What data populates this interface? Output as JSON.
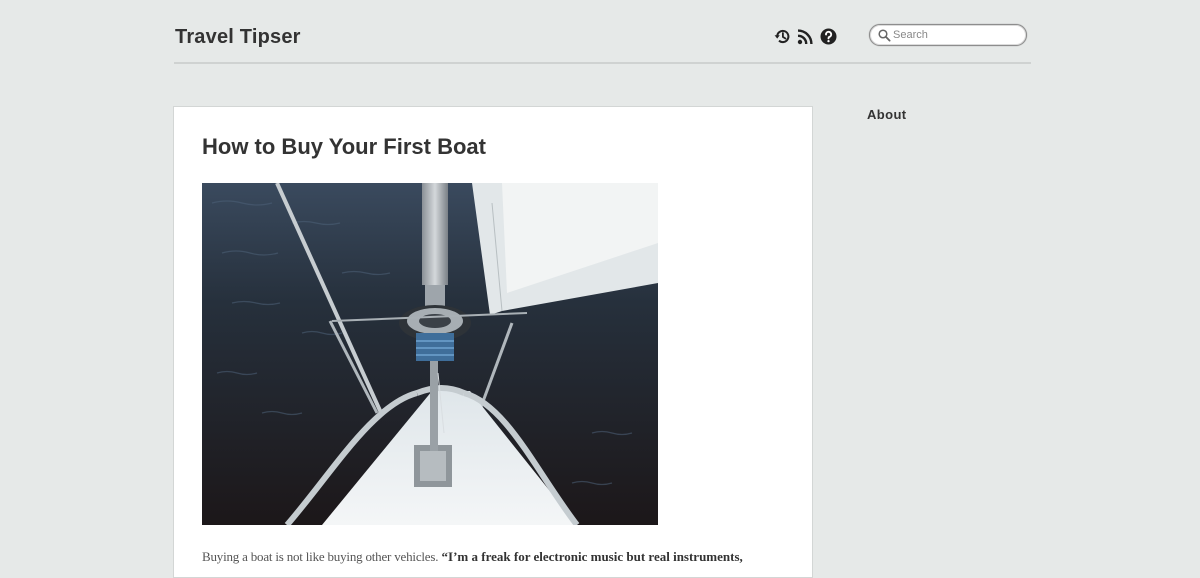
{
  "site": {
    "title": "Travel Tipser"
  },
  "header": {
    "icons": [
      "history-icon",
      "rss-icon",
      "help-icon"
    ],
    "search": {
      "placeholder": "Search",
      "value": ""
    }
  },
  "post": {
    "title": "How to Buy Your First Boat",
    "image": {
      "subject": "sailboat bow and furled sail over dark water"
    },
    "excerpt": {
      "lead": "Buying a boat is not like buying other vehicles.",
      "quote": "“I’m a freak for electronic music but real instruments,"
    }
  },
  "sidebar": {
    "heading": "About"
  },
  "colors": {
    "background": "#e6e9e8",
    "card": "#ffffff",
    "text": "#333333",
    "water": "#1e2125"
  }
}
